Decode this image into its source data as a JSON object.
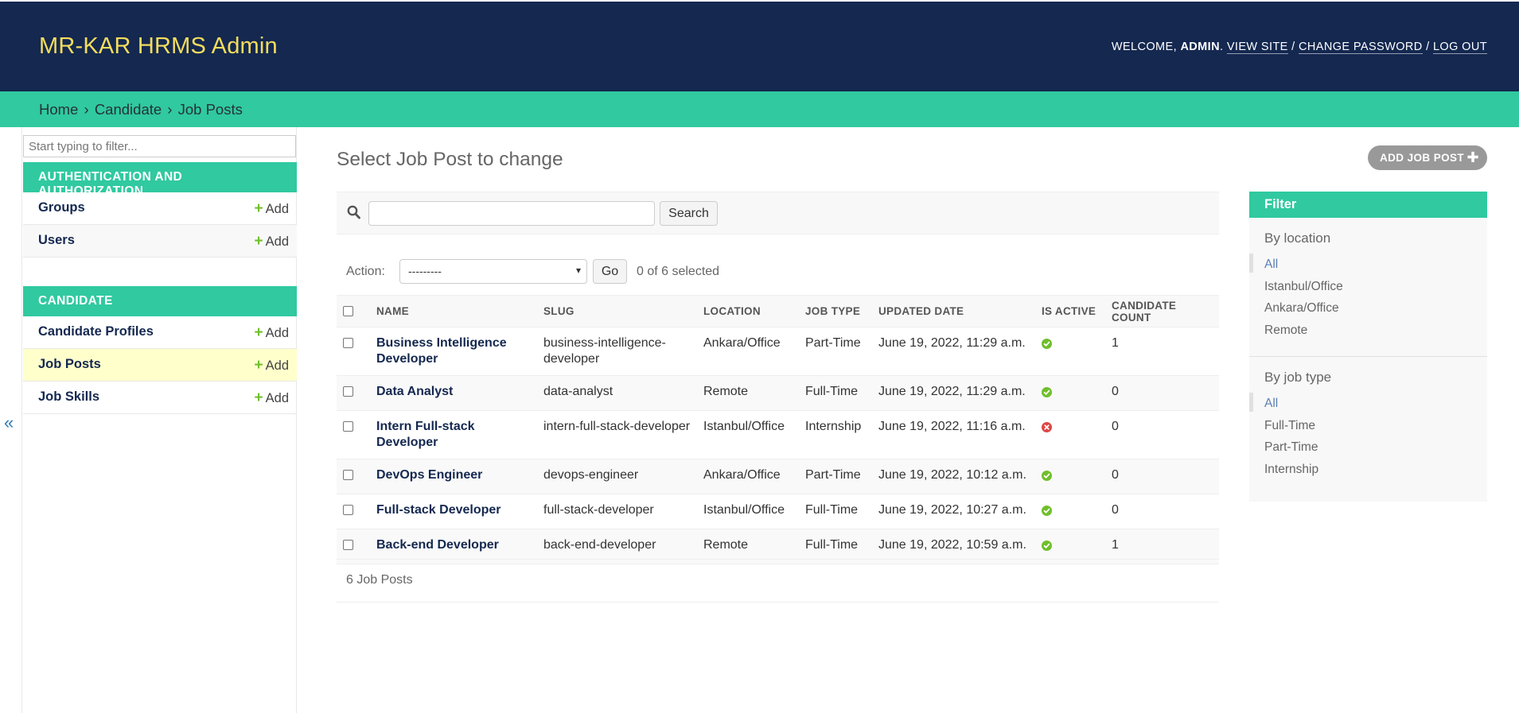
{
  "header": {
    "brand": "MR-KAR HRMS Admin",
    "welcome": "Welcome,",
    "user": "admin",
    "view_site": "View site",
    "change_password": "Change password",
    "log_out": "Log out"
  },
  "breadcrumbs": [
    "Home",
    "Candidate",
    "Job Posts"
  ],
  "sidebar": {
    "filter_placeholder": "Start typing to filter...",
    "collapse_glyph": "«",
    "apps": [
      {
        "caption": "Authentication and Authorization",
        "models": [
          {
            "name": "Groups",
            "add": "Add"
          },
          {
            "name": "Users",
            "add": "Add"
          }
        ]
      },
      {
        "caption": "Candidate",
        "models": [
          {
            "name": "Candidate Profiles",
            "add": "Add"
          },
          {
            "name": "Job Posts",
            "add": "Add"
          },
          {
            "name": "Job Skills",
            "add": "Add"
          }
        ]
      }
    ]
  },
  "content": {
    "title": "Select Job Post to change",
    "add_button": "Add Job Post",
    "search_button": "Search",
    "search_value": "",
    "action_label": "Action:",
    "action_selected": "---------",
    "go_button": "Go",
    "selection_counter": "0 of 6 selected",
    "paginator": "6 Job Posts"
  },
  "table": {
    "columns": [
      "Name",
      "Slug",
      "Location",
      "Job type",
      "Updated date",
      "Is active",
      "Candidate count"
    ],
    "rows": [
      {
        "name": "Business Intelligence Developer",
        "slug": "business-intelligence-developer",
        "location": "Ankara/Office",
        "job_type": "Part-Time",
        "updated": "June 19, 2022, 11:29 a.m.",
        "active": "yes",
        "count": "1"
      },
      {
        "name": "Data Analyst",
        "slug": "data-analyst",
        "location": "Remote",
        "job_type": "Full-Time",
        "updated": "June 19, 2022, 11:29 a.m.",
        "active": "yes",
        "count": "0"
      },
      {
        "name": "Intern Full-stack Developer",
        "slug": "intern-full-stack-developer",
        "location": "Istanbul/Office",
        "job_type": "Internship",
        "updated": "June 19, 2022, 11:16 a.m.",
        "active": "no",
        "count": "0"
      },
      {
        "name": "DevOps Engineer",
        "slug": "devops-engineer",
        "location": "Ankara/Office",
        "job_type": "Part-Time",
        "updated": "June 19, 2022, 10:12 a.m.",
        "active": "yes",
        "count": "0"
      },
      {
        "name": "Full-stack Developer",
        "slug": "full-stack-developer",
        "location": "Istanbul/Office",
        "job_type": "Full-Time",
        "updated": "June 19, 2022, 10:27 a.m.",
        "active": "yes",
        "count": "0"
      },
      {
        "name": "Back-end Developer",
        "slug": "back-end-developer",
        "location": "Remote",
        "job_type": "Full-Time",
        "updated": "June 19, 2022, 10:59 a.m.",
        "active": "yes",
        "count": "1"
      }
    ]
  },
  "filter": {
    "title": "Filter",
    "sections": [
      {
        "title": "By location",
        "options": [
          "All",
          "Istanbul/Office",
          "Ankara/Office",
          "Remote"
        ]
      },
      {
        "title": "By job type",
        "options": [
          "All",
          "Full-Time",
          "Part-Time",
          "Internship"
        ]
      }
    ]
  },
  "colors": {
    "header_bg": "#142850",
    "accent": "#30c9a0",
    "brand_text": "#f5dd5d",
    "active_yes": "#70bf2b",
    "active_no": "#dd4646"
  },
  "icons": {
    "search": "search-icon",
    "add": "plus-icon",
    "active_yes": "check-circle-icon",
    "active_no": "x-circle-icon"
  }
}
